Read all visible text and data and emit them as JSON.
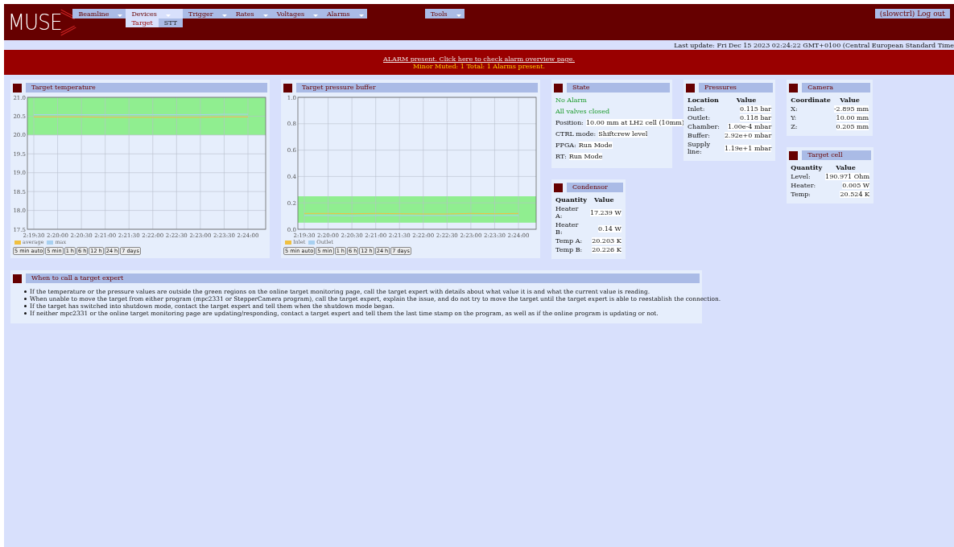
{
  "header": {
    "logo": "MUSE",
    "menu": [
      {
        "label": "Beamline",
        "selected": false
      },
      {
        "label": "Devices",
        "selected": true
      },
      {
        "label": "Trigger",
        "selected": false
      },
      {
        "label": "Rates",
        "selected": false
      },
      {
        "label": "Voltages",
        "selected": false
      },
      {
        "label": "Alarms",
        "selected": false
      }
    ],
    "submenu": [
      {
        "label": "Target",
        "selected": true
      },
      {
        "label": "STT",
        "selected": false
      }
    ],
    "tools": "Tools",
    "user_button": "(slowctrl) Log out"
  },
  "last_update": "Last update: Fri Dec 15 2023 02:24:22 GMT+0100 (Central European Standard Time",
  "alarm": {
    "link": "ALARM present. Click here to check alarm overview page.",
    "summary": "Minor Muted: 1 Total: 1 Alarms present."
  },
  "columns": [
    [
      {
        "kind": "chart",
        "title": "Target temperature",
        "chart_data": {
          "type": "line",
          "categories": [
            "2:19:30",
            "2:20:00",
            "2:20:30",
            "2:21:00",
            "2:21:30",
            "2:22:00",
            "2:22:30",
            "2:23:00",
            "2:23:30",
            "2:24:00"
          ],
          "ylim": [
            17.5,
            21.0
          ],
          "yticks": [
            {
              "value": 17.5,
              "label": "17.5"
            },
            {
              "value": 18,
              "label": "18.0"
            },
            {
              "value": 18.5,
              "label": "18.5"
            },
            {
              "value": 19,
              "label": "19.0"
            },
            {
              "value": 19.5,
              "label": "19.5"
            },
            {
              "value": 20,
              "label": "20.0"
            },
            {
              "value": 20.5,
              "label": "20.5"
            },
            {
              "value": 21,
              "label": "21.0"
            }
          ],
          "grid": true,
          "series": [
            {
              "name": "average",
              "color": "#f0c040",
              "values": [
                20.48,
                20.48,
                20.48,
                20.47,
                20.47,
                20.47,
                20.47,
                20.47,
                20.48,
                20.48
              ]
            },
            {
              "name": "max",
              "color": "#a8d0f0",
              "values": [
                20.54,
                20.54,
                20.54,
                20.54,
                20.54,
                20.54,
                20.54,
                20.54,
                20.55,
                20.55
              ]
            }
          ],
          "bands": [
            {
              "axis": "y",
              "from": 20.0,
              "to": 21.0,
              "color": "#90ee90"
            }
          ]
        },
        "ranges": [
          "5 min auto",
          "5 min",
          "1 h",
          "6 h",
          "12 h",
          "24 h",
          "7 days"
        ]
      }
    ],
    [
      {
        "kind": "chart",
        "title": "Target pressure buffer",
        "chart_data": {
          "type": "line",
          "categories": [
            "2:19:30",
            "2:20:00",
            "2:20:30",
            "2:21:00",
            "2:21:30",
            "2:22:00",
            "2:22:30",
            "2:23:00",
            "2:23:30",
            "2:24:00"
          ],
          "ylim": [
            0,
            1.0
          ],
          "yticks": [
            {
              "value": 0,
              "label": "0.0"
            },
            {
              "value": 0.2,
              "label": "0.2"
            },
            {
              "value": 0.4,
              "label": "0.4"
            },
            {
              "value": 0.6,
              "label": "0.6"
            },
            {
              "value": 0.8,
              "label": "0.8"
            },
            {
              "value": 1,
              "label": "1.0"
            }
          ],
          "grid": true,
          "series": [
            {
              "name": "Inlet",
              "color": "#f0c040",
              "values": [
                0.12,
                0.12,
                0.118,
                0.12,
                0.118,
                0.116,
                0.116,
                0.12,
                0.118,
                0.12
              ]
            },
            {
              "name": "Outlet",
              "color": "#a8d0f0",
              "values": [
                0.104,
                0.104,
                0.102,
                0.104,
                0.104,
                0.104,
                0.104,
                0.104,
                0.104,
                0.104
              ]
            }
          ],
          "bands": [
            {
              "axis": "y",
              "from": 0.05,
              "to": 0.25,
              "color": "#90ee90"
            }
          ]
        },
        "ranges": [
          "5 min auto",
          "5 min",
          "1 h",
          "6 h",
          "12 h",
          "24 h",
          "7 days"
        ]
      }
    ],
    [
      {
        "kind": "state",
        "title": "State",
        "lines": [
          {
            "kind": "status",
            "text": "No Alarm"
          },
          {
            "kind": "status",
            "text": "All valves closed"
          },
          {
            "kind": "field",
            "label": "Position:",
            "value": "10.00 mm at LH2 cell (10mm)"
          },
          {
            "kind": "field",
            "label": "CTRL mode:",
            "value": "Shiftcrew level"
          },
          {
            "kind": "field",
            "label": "FPGA:",
            "value": "Run Mode"
          },
          {
            "kind": "field",
            "label": "RT:",
            "value": "Run Mode"
          }
        ]
      },
      {
        "kind": "table",
        "title": "Condensor",
        "columns": [
          "Quantity",
          "Value"
        ],
        "rows": [
          [
            "Heater A:",
            "17.239 W"
          ],
          [
            "Heater B:",
            "0.14 W"
          ],
          [
            "Temp A:",
            "20.203 K"
          ],
          [
            "Temp B:",
            "20.226 K"
          ]
        ]
      }
    ],
    [
      {
        "kind": "table",
        "title": "Pressures",
        "columns": [
          "Location",
          "Value"
        ],
        "rows": [
          [
            "Inlet:",
            "0.115 bar"
          ],
          [
            "Outlet:",
            "0.118 bar"
          ],
          [
            "Chamber:",
            "1.00e-4 mbar"
          ],
          [
            "Buffer:",
            "2.92e+0 mbar"
          ],
          [
            "Supply line:",
            "1.19e+1 mbar"
          ]
        ]
      }
    ],
    [
      {
        "kind": "table",
        "title": "Camera",
        "columns": [
          "Coordinate",
          "Value"
        ],
        "rows": [
          [
            "X:",
            "-2.895 mm"
          ],
          [
            "Y:",
            "10.00 mm"
          ],
          [
            "Z:",
            "0.205 mm"
          ]
        ]
      },
      {
        "kind": "table",
        "title": "Target cell",
        "columns": [
          "Quantity",
          "Value"
        ],
        "rows": [
          [
            "Level:",
            "190.971 Ohm"
          ],
          [
            "Heater:",
            "0.005 W"
          ],
          [
            "Temp:",
            "20.524 K"
          ]
        ]
      }
    ]
  ],
  "expert_panel": {
    "title": "When to call a target expert",
    "items": [
      "If the temperature or the pressure values are outside the green regions on the online target monitoring page, call the target expert with details about what value it is and what the current value is reading.",
      "When unable to move the target from either program (mpc2331 or StepperCamera program), call the target expert, explain the issue, and do not try to move the target until the target expert is able to reestablish the connection.",
      "If the target has switched into shutdown mode, contact the target expert and tell them when the shutdown mode began.",
      "If neither mpc2331 or the online target monitoring page are updating/responding, contact a target expert and tell them the last time stamp on the program, as well as if the online program is updating or not."
    ]
  }
}
